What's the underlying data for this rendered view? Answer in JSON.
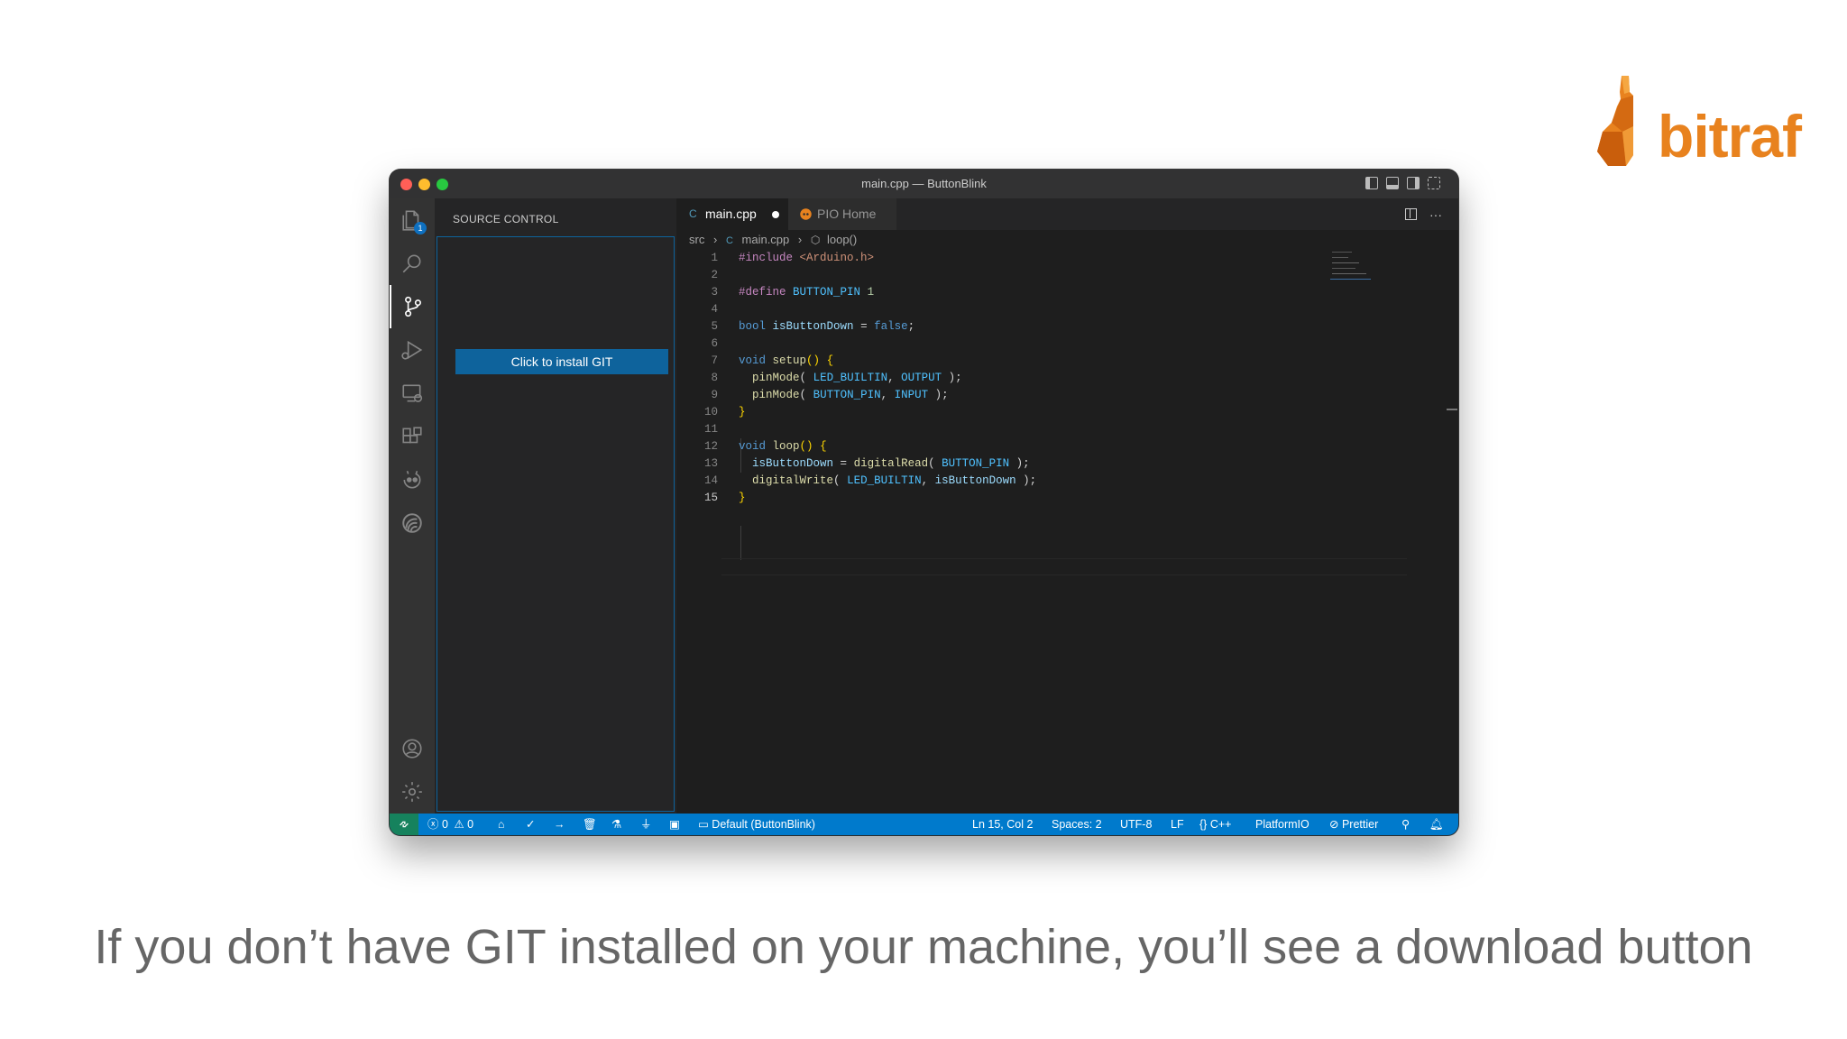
{
  "logo": {
    "text": "bitraf"
  },
  "caption": "If you don’t have GIT installed on your machine, you’ll see a download button",
  "window": {
    "title": "main.cpp — ButtonBlink"
  },
  "activity_bar": {
    "explorer_badge": "1"
  },
  "sidebar": {
    "header": "SOURCE CONTROL",
    "install_button": "Click to install GIT"
  },
  "tabs": [
    {
      "label": "main.cpp",
      "icon": "C"
    },
    {
      "label": "PIO Home",
      "icon": "platformio-icon"
    }
  ],
  "breadcrumb": [
    "src",
    "main.cpp",
    "loop()"
  ],
  "editor": {
    "line_numbers": [
      "1",
      "2",
      "3",
      "4",
      "5",
      "6",
      "7",
      "8",
      "9",
      "10",
      "11",
      "12",
      "13",
      "14",
      "15"
    ],
    "current_line": "15"
  },
  "statusbar": {
    "errors": "0",
    "warnings": "0",
    "environment": "Default (ButtonBlink)",
    "position": "Ln 15, Col 2",
    "spaces": "Spaces: 2",
    "encoding": "UTF-8",
    "eol": "LF",
    "language": "C++",
    "platform": "PlatformIO",
    "formatter": "Prettier"
  },
  "colors": {
    "accent": "#007acc",
    "logo": "#e8821e",
    "button": "#0e639c"
  }
}
